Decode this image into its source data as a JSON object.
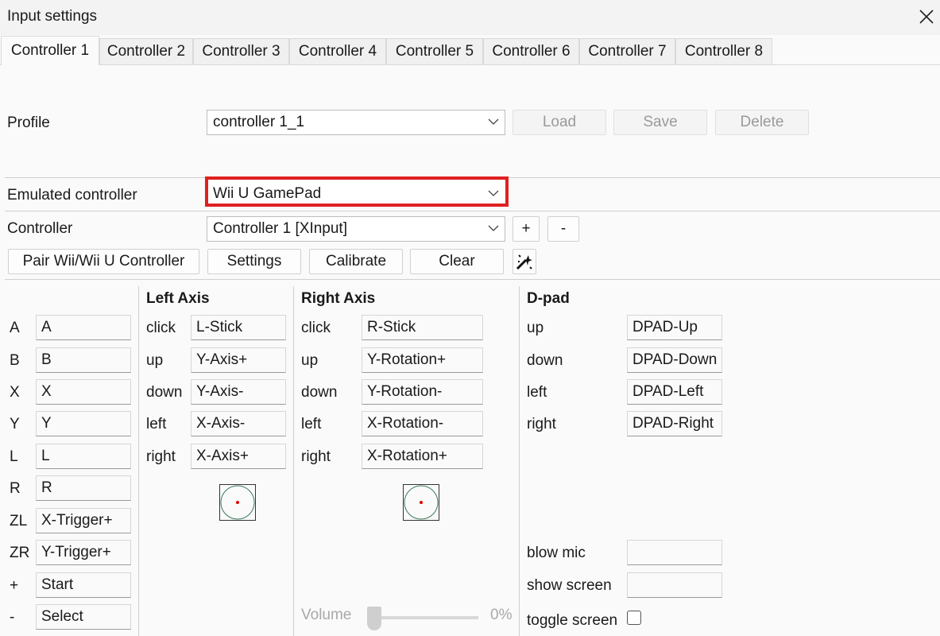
{
  "window": {
    "title": "Input settings"
  },
  "tabs": [
    "Controller 1",
    "Controller 2",
    "Controller 3",
    "Controller 4",
    "Controller 5",
    "Controller 6",
    "Controller 7",
    "Controller 8"
  ],
  "profile": {
    "label": "Profile",
    "value": "controller 1_1",
    "load": "Load",
    "save": "Save",
    "delete": "Delete"
  },
  "emulated": {
    "label": "Emulated controller",
    "value": "Wii U GamePad"
  },
  "controller": {
    "label": "Controller",
    "value": "Controller 1 [XInput]",
    "add": "+",
    "remove": "-"
  },
  "actions": {
    "pair": "Pair Wii/Wii U Controller",
    "settings": "Settings",
    "calibrate": "Calibrate",
    "clear": "Clear"
  },
  "buttons": [
    {
      "name": "A",
      "value": "A"
    },
    {
      "name": "B",
      "value": "B"
    },
    {
      "name": "X",
      "value": "X"
    },
    {
      "name": "Y",
      "value": "Y"
    },
    {
      "name": "L",
      "value": "L"
    },
    {
      "name": "R",
      "value": "R"
    },
    {
      "name": "ZL",
      "value": "X-Trigger+"
    },
    {
      "name": "ZR",
      "value": "Y-Trigger+"
    },
    {
      "name": "+",
      "value": "Start"
    },
    {
      "name": "-",
      "value": "Select"
    }
  ],
  "left_axis": {
    "title": "Left Axis",
    "rows": [
      {
        "name": "click",
        "value": "L-Stick"
      },
      {
        "name": "up",
        "value": "Y-Axis+"
      },
      {
        "name": "down",
        "value": "Y-Axis-"
      },
      {
        "name": "left",
        "value": "X-Axis-"
      },
      {
        "name": "right",
        "value": "X-Axis+"
      }
    ]
  },
  "right_axis": {
    "title": "Right Axis",
    "rows": [
      {
        "name": "click",
        "value": "R-Stick"
      },
      {
        "name": "up",
        "value": "Y-Rotation+"
      },
      {
        "name": "down",
        "value": "Y-Rotation-"
      },
      {
        "name": "left",
        "value": "X-Rotation-"
      },
      {
        "name": "right",
        "value": "X-Rotation+"
      }
    ]
  },
  "dpad": {
    "title": "D-pad",
    "rows": [
      {
        "name": "up",
        "value": "DPAD-Up"
      },
      {
        "name": "down",
        "value": "DPAD-Down"
      },
      {
        "name": "left",
        "value": "DPAD-Left"
      },
      {
        "name": "right",
        "value": "DPAD-Right"
      }
    ]
  },
  "extra": {
    "blow_mic": "blow mic",
    "blow_mic_value": "",
    "show_screen": "show screen",
    "show_screen_value": "",
    "toggle_screen": "toggle screen",
    "toggle_checked": false
  },
  "volume": {
    "label": "Volume",
    "value_text": "0%",
    "level": 0
  },
  "colors": {
    "highlight": "#e02020",
    "stick_dot": "#e00000"
  }
}
